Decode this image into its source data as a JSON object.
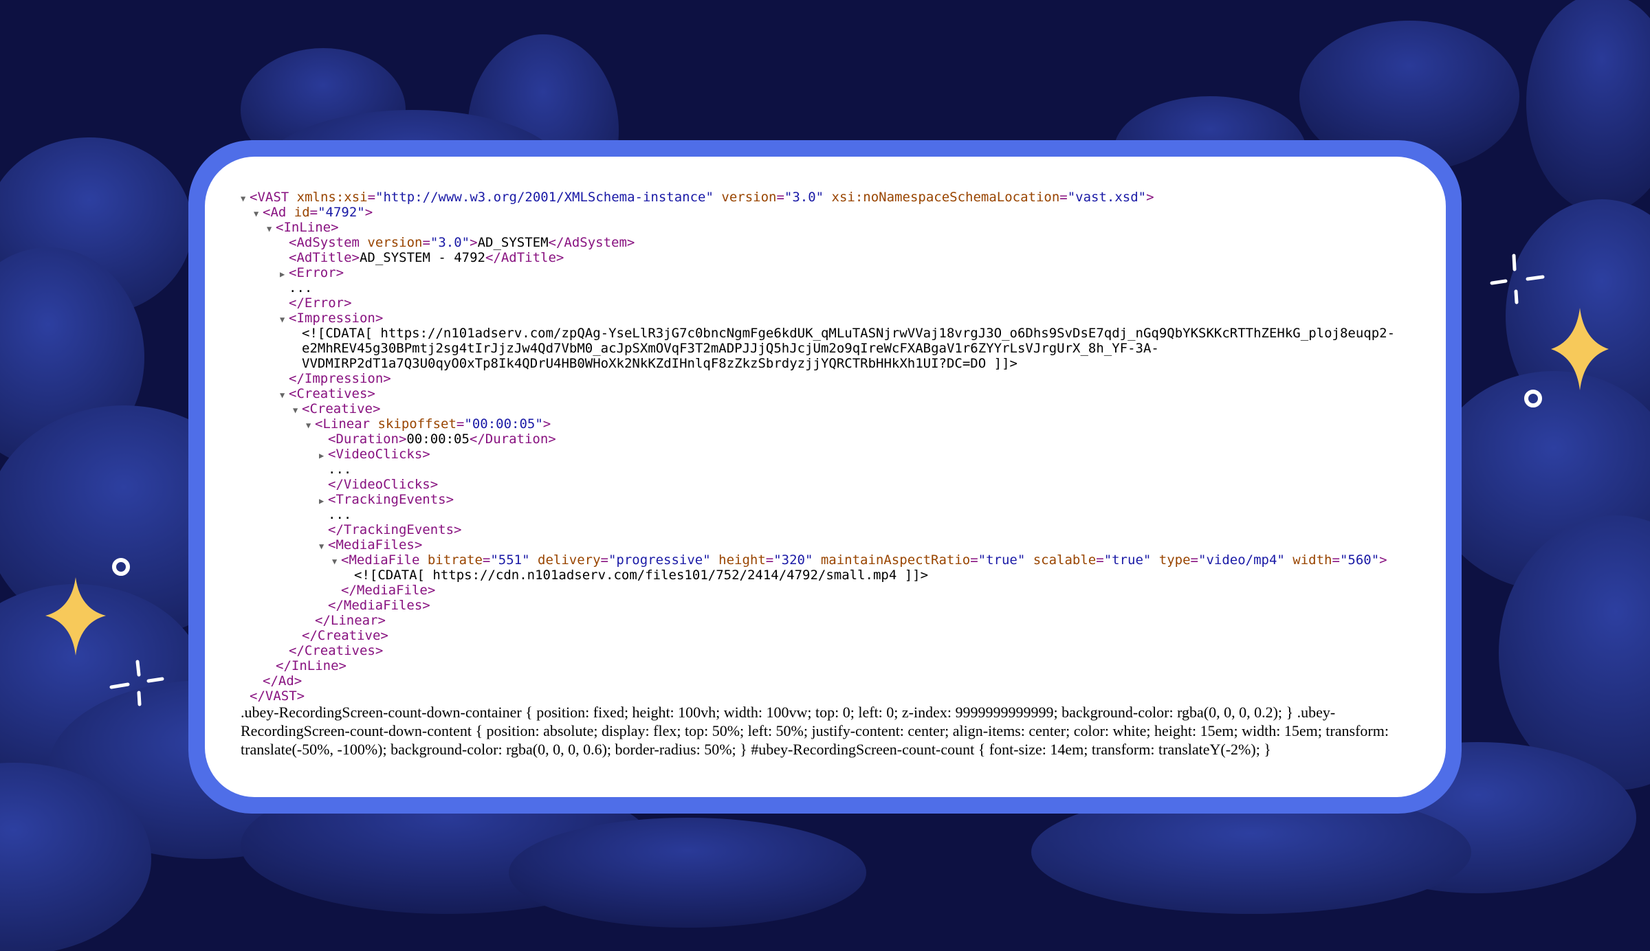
{
  "lines": [
    {
      "indent": 0,
      "tri": "▼",
      "parts": [
        {
          "c": "tag",
          "t": "<VAST"
        },
        {
          "c": "an",
          "t": " xmlns:xsi"
        },
        {
          "c": "tag",
          "t": "="
        },
        {
          "c": "av",
          "t": "\"http://www.w3.org/2001/XMLSchema-instance\""
        },
        {
          "c": "an",
          "t": " version"
        },
        {
          "c": "tag",
          "t": "="
        },
        {
          "c": "av",
          "t": "\"3.0\""
        },
        {
          "c": "an",
          "t": " xsi:noNamespaceSchemaLocation"
        },
        {
          "c": "tag",
          "t": "="
        },
        {
          "c": "av",
          "t": "\"vast.xsd\""
        },
        {
          "c": "tag",
          "t": ">"
        }
      ]
    },
    {
      "indent": 1,
      "tri": "▼",
      "parts": [
        {
          "c": "tag",
          "t": "<Ad"
        },
        {
          "c": "an",
          "t": " id"
        },
        {
          "c": "tag",
          "t": "="
        },
        {
          "c": "av",
          "t": "\"4792\""
        },
        {
          "c": "tag",
          "t": ">"
        }
      ]
    },
    {
      "indent": 2,
      "tri": "▼",
      "parts": [
        {
          "c": "tag",
          "t": "<InLine>"
        }
      ]
    },
    {
      "indent": 3,
      "tri": "",
      "parts": [
        {
          "c": "tag",
          "t": "<AdSystem"
        },
        {
          "c": "an",
          "t": " version"
        },
        {
          "c": "tag",
          "t": "="
        },
        {
          "c": "av",
          "t": "\"3.0\""
        },
        {
          "c": "tag",
          "t": ">"
        },
        {
          "c": "txt",
          "t": "AD_SYSTEM"
        },
        {
          "c": "tag",
          "t": "</AdSystem>"
        }
      ]
    },
    {
      "indent": 3,
      "tri": "",
      "parts": [
        {
          "c": "tag",
          "t": "<AdTitle>"
        },
        {
          "c": "txt",
          "t": "AD_SYSTEM - 4792"
        },
        {
          "c": "tag",
          "t": "</AdTitle>"
        }
      ]
    },
    {
      "indent": 3,
      "tri": "▶",
      "parts": [
        {
          "c": "tag",
          "t": "<Error>"
        }
      ]
    },
    {
      "indent": 3,
      "tri": "",
      "parts": [
        {
          "c": "txt",
          "t": "..."
        }
      ]
    },
    {
      "indent": 3,
      "tri": "",
      "parts": [
        {
          "c": "tag",
          "t": "</Error>"
        }
      ]
    },
    {
      "indent": 3,
      "tri": "▼",
      "parts": [
        {
          "c": "tag",
          "t": "<Impression>"
        }
      ]
    },
    {
      "indent": 4,
      "tri": "",
      "parts": [
        {
          "c": "txt",
          "t": "<![CDATA[ https://n101adserv.com/zpQAg-YseLlR3jG7c0bncNgmFge6kdUK_qMLuTASNjrwVVaj18vrgJ3O_o6Dhs9SvDsE7qdj_nGq9QbYKSKKcRTThZEHkG_ploj8euqp2-"
        }
      ]
    },
    {
      "indent": 4,
      "tri": "",
      "parts": [
        {
          "c": "txt",
          "t": "e2MhREV45g30BPmtj2sg4tIrJjzJw4Qd7VbM0_acJpSXmOVqF3T2mADPJJjQ5hJcjUm2o9qIreWcFXABgaV1r6ZYYrLsVJrgUrX_8h_YF-3A-"
        }
      ]
    },
    {
      "indent": 4,
      "tri": "",
      "parts": [
        {
          "c": "txt",
          "t": "VVDMIRP2dT1a7Q3U0qyO0xTp8Ik4QDrU4HB0WHoXk2NkKZdIHnlqF8zZkzSbrdyzjjYQRCTRbHHkXh1UI?DC=DO ]]>"
        }
      ]
    },
    {
      "indent": 3,
      "tri": "",
      "parts": [
        {
          "c": "tag",
          "t": "</Impression>"
        }
      ]
    },
    {
      "indent": 3,
      "tri": "▼",
      "parts": [
        {
          "c": "tag",
          "t": "<Creatives>"
        }
      ]
    },
    {
      "indent": 4,
      "tri": "▼",
      "parts": [
        {
          "c": "tag",
          "t": "<Creative>"
        }
      ]
    },
    {
      "indent": 5,
      "tri": "▼",
      "parts": [
        {
          "c": "tag",
          "t": "<Linear"
        },
        {
          "c": "an",
          "t": " skipoffset"
        },
        {
          "c": "tag",
          "t": "="
        },
        {
          "c": "av",
          "t": "\"00:00:05\""
        },
        {
          "c": "tag",
          "t": ">"
        }
      ]
    },
    {
      "indent": 6,
      "tri": "",
      "parts": [
        {
          "c": "tag",
          "t": "<Duration>"
        },
        {
          "c": "txt",
          "t": "00:00:05"
        },
        {
          "c": "tag",
          "t": "</Duration>"
        }
      ]
    },
    {
      "indent": 6,
      "tri": "▶",
      "parts": [
        {
          "c": "tag",
          "t": "<VideoClicks>"
        }
      ]
    },
    {
      "indent": 6,
      "tri": "",
      "parts": [
        {
          "c": "txt",
          "t": "..."
        }
      ]
    },
    {
      "indent": 6,
      "tri": "",
      "parts": [
        {
          "c": "tag",
          "t": "</VideoClicks>"
        }
      ]
    },
    {
      "indent": 6,
      "tri": "▶",
      "parts": [
        {
          "c": "tag",
          "t": "<TrackingEvents>"
        }
      ]
    },
    {
      "indent": 6,
      "tri": "",
      "parts": [
        {
          "c": "txt",
          "t": "..."
        }
      ]
    },
    {
      "indent": 6,
      "tri": "",
      "parts": [
        {
          "c": "tag",
          "t": "</TrackingEvents>"
        }
      ]
    },
    {
      "indent": 6,
      "tri": "▼",
      "parts": [
        {
          "c": "tag",
          "t": "<MediaFiles>"
        }
      ]
    },
    {
      "indent": 7,
      "tri": "▼",
      "parts": [
        {
          "c": "tag",
          "t": "<MediaFile"
        },
        {
          "c": "an",
          "t": " bitrate"
        },
        {
          "c": "tag",
          "t": "="
        },
        {
          "c": "av",
          "t": "\"551\""
        },
        {
          "c": "an",
          "t": " delivery"
        },
        {
          "c": "tag",
          "t": "="
        },
        {
          "c": "av",
          "t": "\"progressive\""
        },
        {
          "c": "an",
          "t": " height"
        },
        {
          "c": "tag",
          "t": "="
        },
        {
          "c": "av",
          "t": "\"320\""
        },
        {
          "c": "an",
          "t": " maintainAspectRatio"
        },
        {
          "c": "tag",
          "t": "="
        },
        {
          "c": "av",
          "t": "\"true\""
        },
        {
          "c": "an",
          "t": " scalable"
        },
        {
          "c": "tag",
          "t": "="
        },
        {
          "c": "av",
          "t": "\"true\""
        },
        {
          "c": "an",
          "t": " type"
        },
        {
          "c": "tag",
          "t": "="
        },
        {
          "c": "av",
          "t": "\"video/mp4\""
        },
        {
          "c": "an",
          "t": " width"
        },
        {
          "c": "tag",
          "t": "="
        },
        {
          "c": "av",
          "t": "\"560\""
        },
        {
          "c": "tag",
          "t": ">"
        }
      ]
    },
    {
      "indent": 8,
      "tri": "",
      "parts": [
        {
          "c": "txt",
          "t": "<![CDATA[ https://cdn.n101adserv.com/files101/752/2414/4792/small.mp4 ]]>"
        }
      ]
    },
    {
      "indent": 7,
      "tri": "",
      "parts": [
        {
          "c": "tag",
          "t": "</MediaFile>"
        }
      ]
    },
    {
      "indent": 6,
      "tri": "",
      "parts": [
        {
          "c": "tag",
          "t": "</MediaFiles>"
        }
      ]
    },
    {
      "indent": 5,
      "tri": "",
      "parts": [
        {
          "c": "tag",
          "t": "</Linear>"
        }
      ]
    },
    {
      "indent": 4,
      "tri": "",
      "parts": [
        {
          "c": "tag",
          "t": "</Creative>"
        }
      ]
    },
    {
      "indent": 3,
      "tri": "",
      "parts": [
        {
          "c": "tag",
          "t": "</Creatives>"
        }
      ]
    },
    {
      "indent": 2,
      "tri": "",
      "parts": [
        {
          "c": "tag",
          "t": "</InLine>"
        }
      ]
    },
    {
      "indent": 1,
      "tri": "",
      "parts": [
        {
          "c": "tag",
          "t": "</Ad>"
        }
      ]
    },
    {
      "indent": 0,
      "tri": "",
      "parts": [
        {
          "c": "tag",
          "t": "</VAST>"
        }
      ]
    }
  ],
  "css_text": ".ubey-RecordingScreen-count-down-container { position: fixed; height: 100vh; width: 100vw; top: 0; left: 0; z-index: 9999999999999; background-color: rgba(0, 0, 0, 0.2); } .ubey-RecordingScreen-count-down-content { position: absolute; display: flex; top: 50%; left: 50%; justify-content: center; align-items: center; color: white; height: 15em; width: 15em; transform: translate(-50%, -100%); background-color: rgba(0, 0, 0, 0.6); border-radius: 50%; } #ubey-RecordingScreen-count-count { font-size: 14em; transform: translateY(-2%); }",
  "colors": {
    "background": "#0d1142",
    "cloud_dark": "#1a2570",
    "cloud_mid": "#24348c",
    "frame": "#4f6ee8",
    "sparkle_yellow": "#f7c95a",
    "sparkle_white": "#ffffff",
    "tag": "#881280",
    "attr_name": "#994500",
    "attr_value": "#1a1aa6"
  }
}
